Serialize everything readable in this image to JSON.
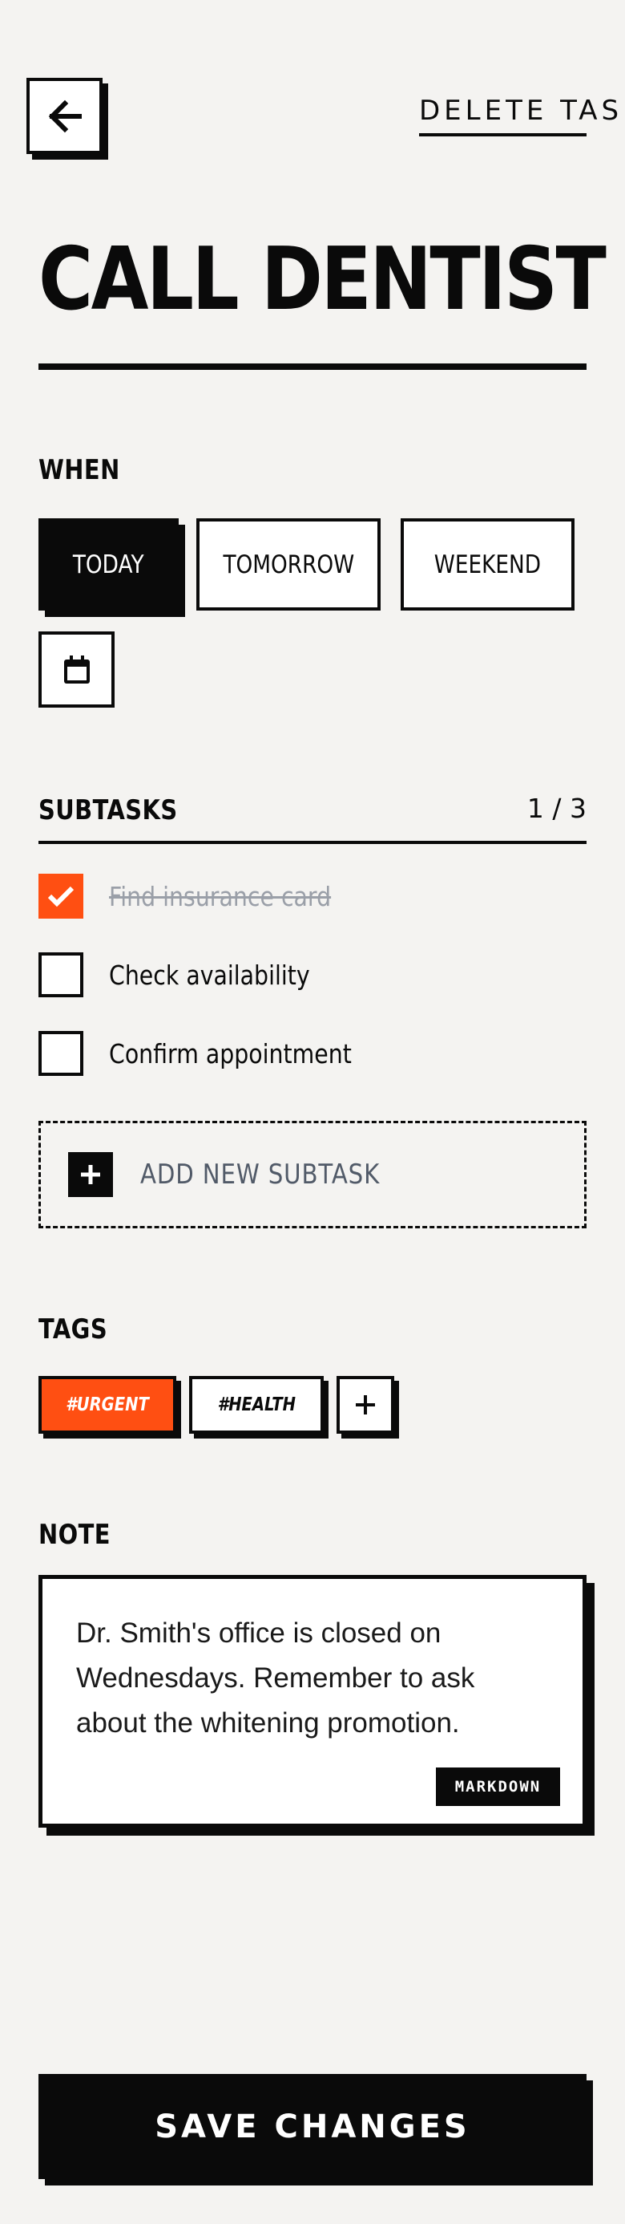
{
  "header": {
    "back_icon": "arrow-left-icon",
    "delete_label": "DELETE TASK"
  },
  "task": {
    "title": "CALL DENTIST"
  },
  "when": {
    "label": "WHEN",
    "options": [
      {
        "label": "TODAY",
        "selected": true
      },
      {
        "label": "TOMORROW",
        "selected": false
      },
      {
        "label": "WEEKEND",
        "selected": false
      }
    ],
    "calendar_icon": "calendar-icon"
  },
  "subtasks": {
    "label": "SUBTASKS",
    "count": "1 / 3",
    "items": [
      {
        "label": "Find insurance card",
        "done": true
      },
      {
        "label": "Check availability",
        "done": false
      },
      {
        "label": "Confirm appointment",
        "done": false
      }
    ],
    "add_label": "ADD NEW SUBTASK"
  },
  "tags": {
    "label": "TAGS",
    "items": [
      {
        "label": "#URGENT",
        "color": "#ff4f12"
      },
      {
        "label": "#HEALTH",
        "color": "#ffffff"
      }
    ],
    "add_icon": "plus-icon"
  },
  "note": {
    "label": "NOTE",
    "text": "Dr. Smith's office is closed on Wednesdays. Remember to ask about the whitening promotion.",
    "badge": "MARKDOWN"
  },
  "footer": {
    "save_label": "SAVE CHANGES"
  },
  "colors": {
    "accent": "#ff4f12",
    "background": "#f4f3f1",
    "ink": "#0a0a0a"
  }
}
